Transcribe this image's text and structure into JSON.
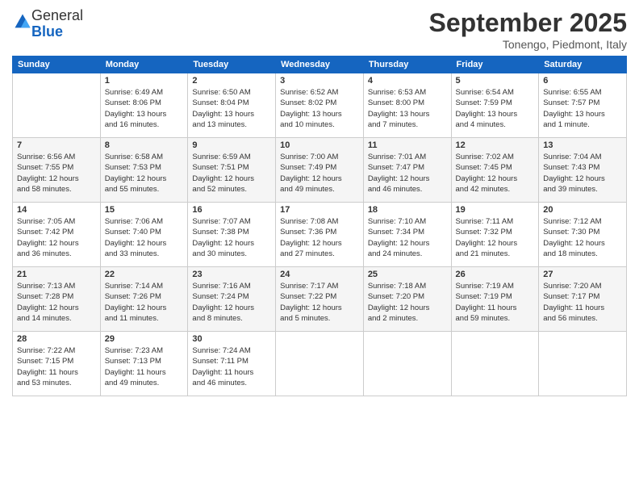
{
  "logo": {
    "general": "General",
    "blue": "Blue"
  },
  "title": "September 2025",
  "location": "Tonengo, Piedmont, Italy",
  "days_of_week": [
    "Sunday",
    "Monday",
    "Tuesday",
    "Wednesday",
    "Thursday",
    "Friday",
    "Saturday"
  ],
  "weeks": [
    [
      {
        "day": "",
        "info": ""
      },
      {
        "day": "1",
        "info": "Sunrise: 6:49 AM\nSunset: 8:06 PM\nDaylight: 13 hours\nand 16 minutes."
      },
      {
        "day": "2",
        "info": "Sunrise: 6:50 AM\nSunset: 8:04 PM\nDaylight: 13 hours\nand 13 minutes."
      },
      {
        "day": "3",
        "info": "Sunrise: 6:52 AM\nSunset: 8:02 PM\nDaylight: 13 hours\nand 10 minutes."
      },
      {
        "day": "4",
        "info": "Sunrise: 6:53 AM\nSunset: 8:00 PM\nDaylight: 13 hours\nand 7 minutes."
      },
      {
        "day": "5",
        "info": "Sunrise: 6:54 AM\nSunset: 7:59 PM\nDaylight: 13 hours\nand 4 minutes."
      },
      {
        "day": "6",
        "info": "Sunrise: 6:55 AM\nSunset: 7:57 PM\nDaylight: 13 hours\nand 1 minute."
      }
    ],
    [
      {
        "day": "7",
        "info": "Sunrise: 6:56 AM\nSunset: 7:55 PM\nDaylight: 12 hours\nand 58 minutes."
      },
      {
        "day": "8",
        "info": "Sunrise: 6:58 AM\nSunset: 7:53 PM\nDaylight: 12 hours\nand 55 minutes."
      },
      {
        "day": "9",
        "info": "Sunrise: 6:59 AM\nSunset: 7:51 PM\nDaylight: 12 hours\nand 52 minutes."
      },
      {
        "day": "10",
        "info": "Sunrise: 7:00 AM\nSunset: 7:49 PM\nDaylight: 12 hours\nand 49 minutes."
      },
      {
        "day": "11",
        "info": "Sunrise: 7:01 AM\nSunset: 7:47 PM\nDaylight: 12 hours\nand 46 minutes."
      },
      {
        "day": "12",
        "info": "Sunrise: 7:02 AM\nSunset: 7:45 PM\nDaylight: 12 hours\nand 42 minutes."
      },
      {
        "day": "13",
        "info": "Sunrise: 7:04 AM\nSunset: 7:43 PM\nDaylight: 12 hours\nand 39 minutes."
      }
    ],
    [
      {
        "day": "14",
        "info": "Sunrise: 7:05 AM\nSunset: 7:42 PM\nDaylight: 12 hours\nand 36 minutes."
      },
      {
        "day": "15",
        "info": "Sunrise: 7:06 AM\nSunset: 7:40 PM\nDaylight: 12 hours\nand 33 minutes."
      },
      {
        "day": "16",
        "info": "Sunrise: 7:07 AM\nSunset: 7:38 PM\nDaylight: 12 hours\nand 30 minutes."
      },
      {
        "day": "17",
        "info": "Sunrise: 7:08 AM\nSunset: 7:36 PM\nDaylight: 12 hours\nand 27 minutes."
      },
      {
        "day": "18",
        "info": "Sunrise: 7:10 AM\nSunset: 7:34 PM\nDaylight: 12 hours\nand 24 minutes."
      },
      {
        "day": "19",
        "info": "Sunrise: 7:11 AM\nSunset: 7:32 PM\nDaylight: 12 hours\nand 21 minutes."
      },
      {
        "day": "20",
        "info": "Sunrise: 7:12 AM\nSunset: 7:30 PM\nDaylight: 12 hours\nand 18 minutes."
      }
    ],
    [
      {
        "day": "21",
        "info": "Sunrise: 7:13 AM\nSunset: 7:28 PM\nDaylight: 12 hours\nand 14 minutes."
      },
      {
        "day": "22",
        "info": "Sunrise: 7:14 AM\nSunset: 7:26 PM\nDaylight: 12 hours\nand 11 minutes."
      },
      {
        "day": "23",
        "info": "Sunrise: 7:16 AM\nSunset: 7:24 PM\nDaylight: 12 hours\nand 8 minutes."
      },
      {
        "day": "24",
        "info": "Sunrise: 7:17 AM\nSunset: 7:22 PM\nDaylight: 12 hours\nand 5 minutes."
      },
      {
        "day": "25",
        "info": "Sunrise: 7:18 AM\nSunset: 7:20 PM\nDaylight: 12 hours\nand 2 minutes."
      },
      {
        "day": "26",
        "info": "Sunrise: 7:19 AM\nSunset: 7:19 PM\nDaylight: 11 hours\nand 59 minutes."
      },
      {
        "day": "27",
        "info": "Sunrise: 7:20 AM\nSunset: 7:17 PM\nDaylight: 11 hours\nand 56 minutes."
      }
    ],
    [
      {
        "day": "28",
        "info": "Sunrise: 7:22 AM\nSunset: 7:15 PM\nDaylight: 11 hours\nand 53 minutes."
      },
      {
        "day": "29",
        "info": "Sunrise: 7:23 AM\nSunset: 7:13 PM\nDaylight: 11 hours\nand 49 minutes."
      },
      {
        "day": "30",
        "info": "Sunrise: 7:24 AM\nSunset: 7:11 PM\nDaylight: 11 hours\nand 46 minutes."
      },
      {
        "day": "",
        "info": ""
      },
      {
        "day": "",
        "info": ""
      },
      {
        "day": "",
        "info": ""
      },
      {
        "day": "",
        "info": ""
      }
    ]
  ]
}
